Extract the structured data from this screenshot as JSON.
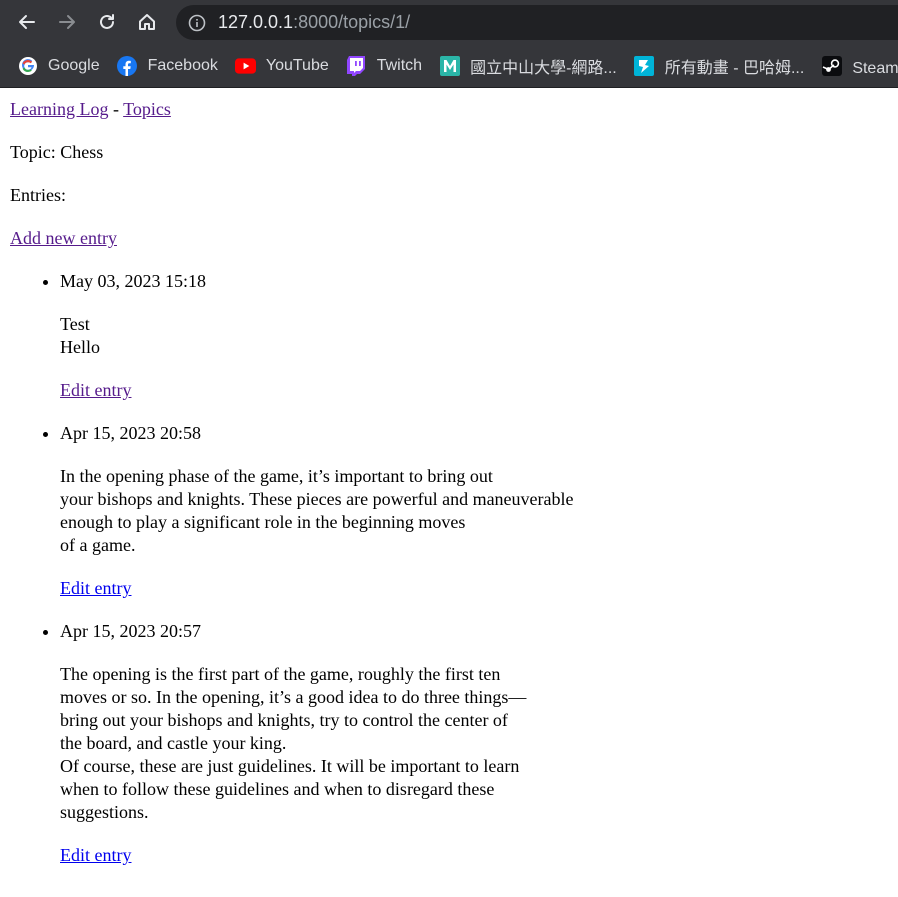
{
  "browser": {
    "url_host": "127.0.0.1",
    "url_rest": ":8000/topics/1/",
    "bookmarks": [
      {
        "label": "Google",
        "icon": "google-icon"
      },
      {
        "label": "Facebook",
        "icon": "facebook-icon"
      },
      {
        "label": "YouTube",
        "icon": "youtube-icon"
      },
      {
        "label": "Twitch",
        "icon": "twitch-icon"
      },
      {
        "label": "國立中山大學-網路...",
        "icon": "nsysu-icon"
      },
      {
        "label": "所有動畫 - 巴哈姆...",
        "icon": "bahamut-icon"
      },
      {
        "label": "Steam 客",
        "icon": "steam-icon"
      }
    ]
  },
  "header": {
    "home_link": "Learning Log",
    "separator": " - ",
    "topics_link": "Topics"
  },
  "topic": {
    "label": "Topic: Chess"
  },
  "entries_label": "Entries:",
  "add_entry_link": "Add new entry",
  "entries": [
    {
      "date": "May 03, 2023 15:18",
      "lines": [
        "Test",
        "Hello"
      ],
      "edit_link": "Edit entry"
    },
    {
      "date": "Apr 15, 2023 20:58",
      "lines": [
        "In the opening phase of the game, it’s important to bring out",
        "your bishops and knights. These pieces are powerful and maneuverable",
        "enough to play a significant role in the beginning moves",
        "of a game."
      ],
      "edit_link": "Edit entry"
    },
    {
      "date": "Apr 15, 2023 20:57",
      "lines": [
        "The opening is the first part of the game, roughly the first ten",
        "moves or so. In the opening, it’s a good idea to do three things—",
        "bring out your bishops and knights, try to control the center of",
        "the board, and castle your king.",
        "Of course, these are just guidelines. It will be important to learn",
        "when to follow these guidelines and when to disregard these",
        "suggestions."
      ],
      "edit_link": "Edit entry"
    }
  ]
}
